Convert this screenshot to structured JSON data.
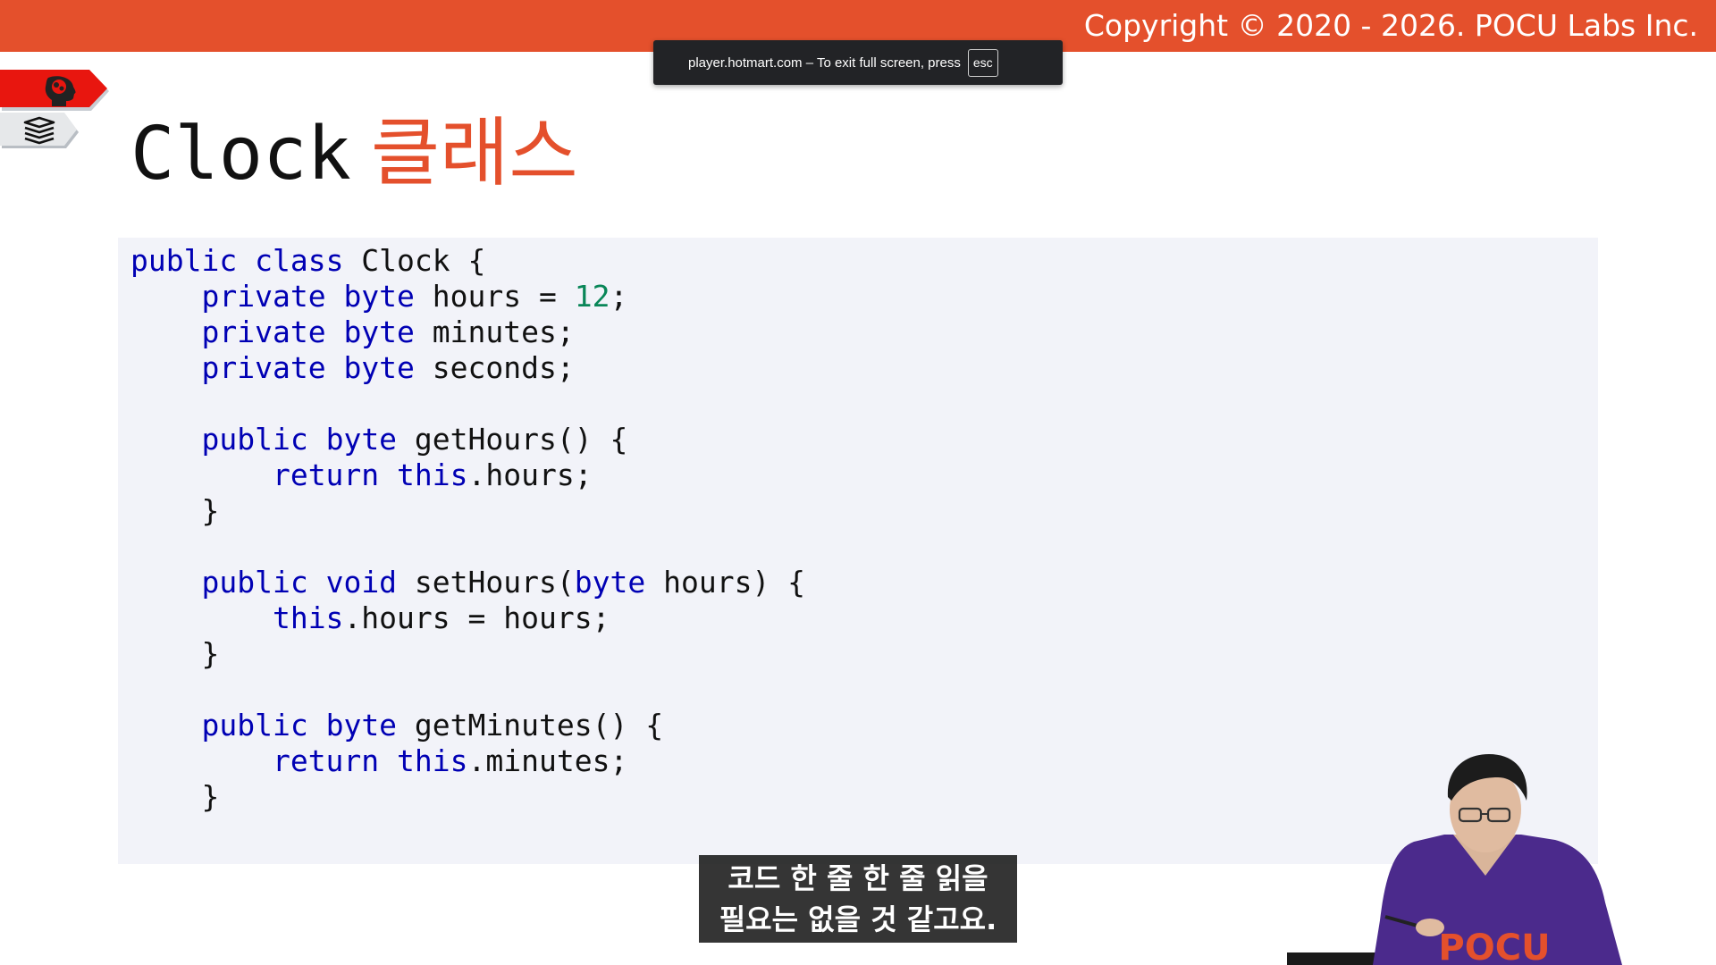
{
  "header": {
    "copyright": "Copyright © 2020 - 2026. POCU Labs Inc.",
    "accent_color": "#e4502c"
  },
  "fullscreen_notice": {
    "text": "player.hotmart.com – To exit full screen, press",
    "key": "esc"
  },
  "side_tabs": {
    "top_icon": "brain-head-icon",
    "bottom_icon": "book-stack-icon"
  },
  "slide": {
    "title_en": "Clock",
    "title_ko": "클래스"
  },
  "code_lines": [
    [
      {
        "t": "public",
        "c": "kw"
      },
      {
        "t": " "
      },
      {
        "t": "class",
        "c": "kw"
      },
      {
        "t": " Clock {"
      }
    ],
    [
      {
        "t": "    "
      },
      {
        "t": "private",
        "c": "kw"
      },
      {
        "t": " "
      },
      {
        "t": "byte",
        "c": "kw"
      },
      {
        "t": " hours = "
      },
      {
        "t": "12",
        "c": "num"
      },
      {
        "t": ";"
      }
    ],
    [
      {
        "t": "    "
      },
      {
        "t": "private",
        "c": "kw"
      },
      {
        "t": " "
      },
      {
        "t": "byte",
        "c": "kw"
      },
      {
        "t": " minutes;"
      }
    ],
    [
      {
        "t": "    "
      },
      {
        "t": "private",
        "c": "kw"
      },
      {
        "t": " "
      },
      {
        "t": "byte",
        "c": "kw"
      },
      {
        "t": " seconds;"
      }
    ],
    [],
    [
      {
        "t": "    "
      },
      {
        "t": "public",
        "c": "kw"
      },
      {
        "t": " "
      },
      {
        "t": "byte",
        "c": "kw"
      },
      {
        "t": " getHours() {"
      }
    ],
    [
      {
        "t": "        "
      },
      {
        "t": "return",
        "c": "kw"
      },
      {
        "t": " "
      },
      {
        "t": "this",
        "c": "kw"
      },
      {
        "t": ".hours;"
      }
    ],
    [
      {
        "t": "    }"
      }
    ],
    [],
    [
      {
        "t": "    "
      },
      {
        "t": "public",
        "c": "kw"
      },
      {
        "t": " "
      },
      {
        "t": "void",
        "c": "kw"
      },
      {
        "t": " setHours("
      },
      {
        "t": "byte",
        "c": "kw"
      },
      {
        "t": " hours) {"
      }
    ],
    [
      {
        "t": "        "
      },
      {
        "t": "this",
        "c": "kw"
      },
      {
        "t": ".hours = hours;"
      }
    ],
    [
      {
        "t": "    }"
      }
    ],
    [],
    [
      {
        "t": "    "
      },
      {
        "t": "public",
        "c": "kw"
      },
      {
        "t": " "
      },
      {
        "t": "byte",
        "c": "kw"
      },
      {
        "t": " getMinutes() {"
      }
    ],
    [
      {
        "t": "        "
      },
      {
        "t": "return",
        "c": "kw"
      },
      {
        "t": " "
      },
      {
        "t": "this",
        "c": "kw"
      },
      {
        "t": ".minutes;"
      }
    ],
    [
      {
        "t": "    }"
      }
    ]
  ],
  "subtitle": {
    "line1": "코드 한 줄 한 줄 읽을",
    "line2": "필요는 없을 것 같고요."
  },
  "presenter": {
    "shirt_text": "POCU"
  }
}
